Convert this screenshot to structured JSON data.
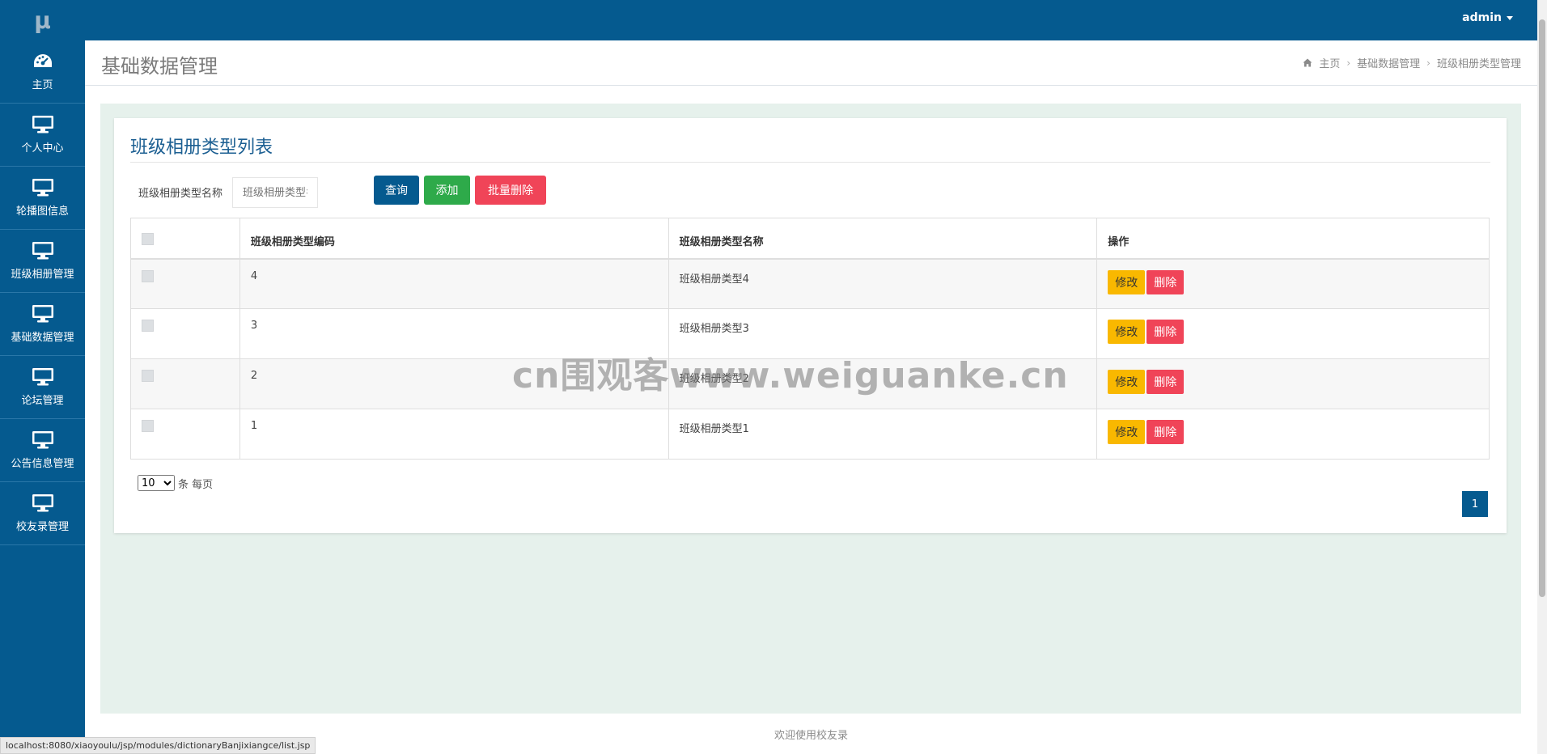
{
  "app": {
    "logo": "μ",
    "user": "admin"
  },
  "sidebar": {
    "items": [
      {
        "label": "主页",
        "icon": "dashboard-icon"
      },
      {
        "label": "个人中心",
        "icon": "monitor-icon"
      },
      {
        "label": "轮播图信息",
        "icon": "monitor-icon"
      },
      {
        "label": "班级相册管理",
        "icon": "monitor-icon"
      },
      {
        "label": "基础数据管理",
        "icon": "monitor-icon"
      },
      {
        "label": "论坛管理",
        "icon": "monitor-icon"
      },
      {
        "label": "公告信息管理",
        "icon": "monitor-icon"
      },
      {
        "label": "校友录管理",
        "icon": "monitor-icon"
      }
    ]
  },
  "header": {
    "title": "基础数据管理",
    "breadcrumb": [
      "主页",
      "基础数据管理",
      "班级相册类型管理"
    ]
  },
  "panel": {
    "title": "班级相册类型列表",
    "search": {
      "label": "班级相册类型名称",
      "placeholder": "班级相册类型名称"
    },
    "buttons": {
      "query": "查询",
      "add": "添加",
      "batch_delete": "批量删除"
    },
    "table": {
      "columns": [
        "",
        "班级相册类型编码",
        "班级相册类型名称",
        "操作"
      ],
      "rows": [
        {
          "code": "4",
          "name": "班级相册类型4"
        },
        {
          "code": "3",
          "name": "班级相册类型3"
        },
        {
          "code": "2",
          "name": "班级相册类型2"
        },
        {
          "code": "1",
          "name": "班级相册类型1"
        }
      ],
      "row_actions": {
        "edit": "修改",
        "delete": "删除"
      }
    },
    "pager": {
      "page_size": "10",
      "page_size_options": [
        "10"
      ],
      "per_page_label": "条 每页",
      "current_page": "1"
    }
  },
  "watermark": "cn围观客www.weiguanke.cn",
  "footer": {
    "text": "欢迎使用校友录"
  },
  "statusbar": {
    "url": "localhost:8080/xiaoyoulu/jsp/modules/dictionaryBanjixiangce/list.jsp"
  },
  "colors": {
    "primary": "#055a8f",
    "success": "#2eaa4a",
    "danger": "#f04458",
    "warning": "#f9b800",
    "content_bg": "#e6f1ec"
  }
}
